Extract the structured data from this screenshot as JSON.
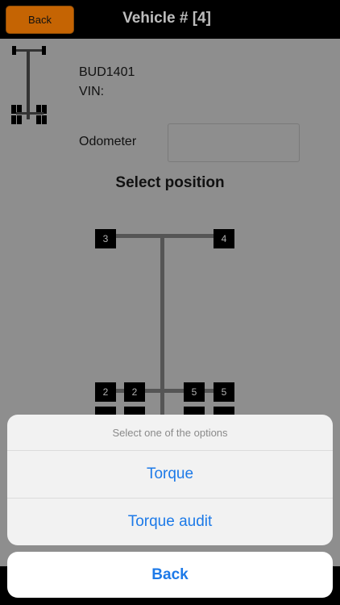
{
  "nav": {
    "back_label": "Back",
    "title": "Vehicle # [4]"
  },
  "vehicle": {
    "plate": "BUD1401",
    "vin_label": "VIN:",
    "odometer_label": "Odometer",
    "odometer_value": ""
  },
  "select_title": "Select position",
  "wheels": {
    "front_left": "3",
    "front_right": "4",
    "rear_left_outer": "2",
    "rear_left_inner": "2",
    "rear_right_inner": "5",
    "rear_right_outer": "5"
  },
  "sheet": {
    "header": "Select one of the options",
    "options": [
      "Torque",
      "Torque audit"
    ],
    "cancel": "Back"
  },
  "colors": {
    "back_button": "#c56403",
    "action_blue": "#1d7ae8",
    "dim_overlay": "#8e8e8e"
  }
}
